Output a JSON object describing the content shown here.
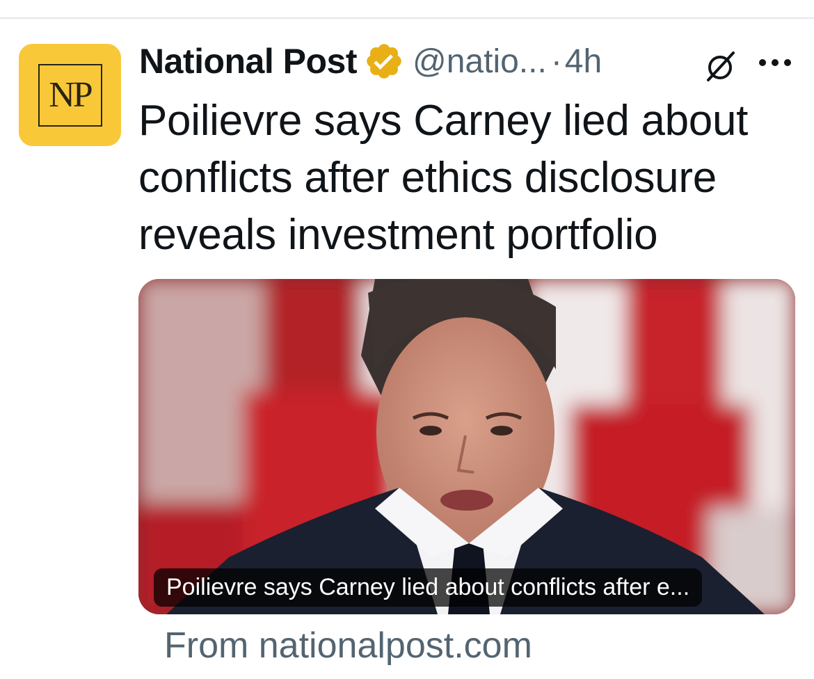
{
  "post": {
    "avatar_text": "NP",
    "display_name": "National Post",
    "handle": "@natio...",
    "separator": "·",
    "time": "4h",
    "headline": "Poilievre says Carney lied about conflicts after ethics disclosure reveals investment portfolio",
    "media": {
      "caption": "Poilievre says Carney lied about conflicts after e..."
    },
    "source": "From nationalpost.com"
  },
  "icons": {
    "verified": "verified-badge-icon",
    "grok": "grok-icon",
    "more": "more-options-icon"
  },
  "colors": {
    "avatar_bg": "#f8c838",
    "verified_gold": "#e8b016",
    "text_primary": "#0f1419",
    "text_secondary": "#536471",
    "flag_red": "#c8232b"
  }
}
